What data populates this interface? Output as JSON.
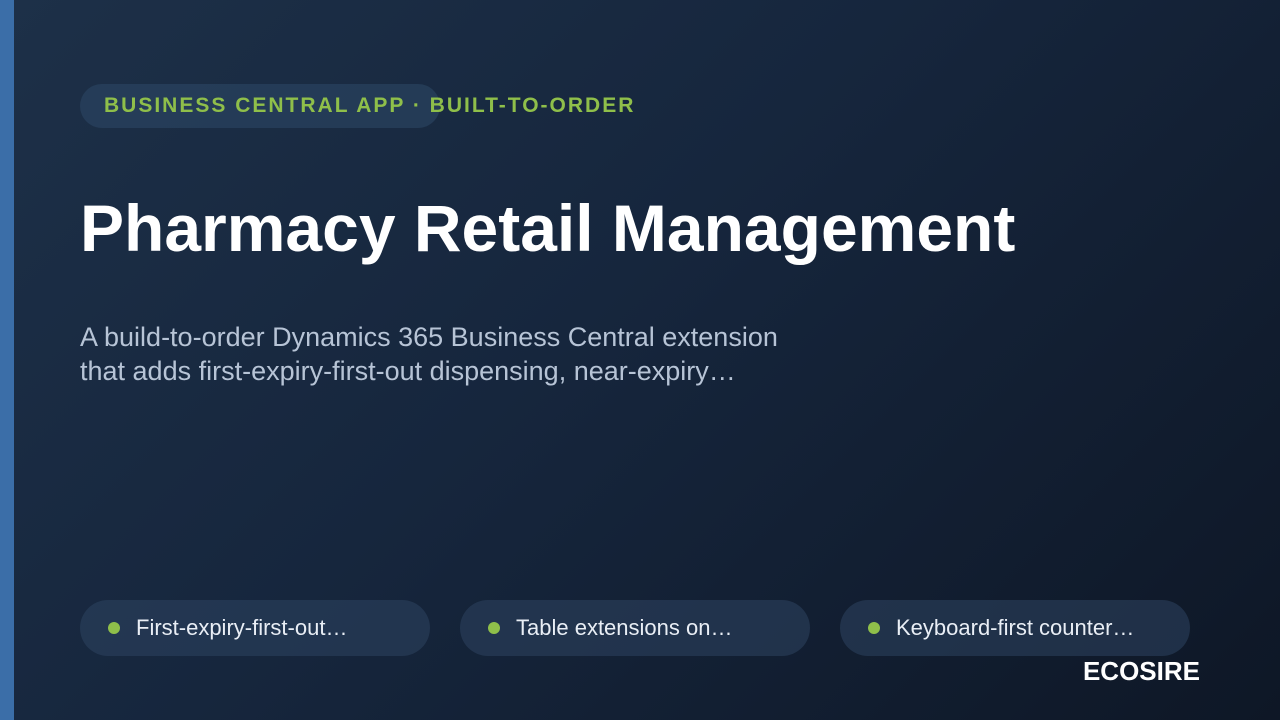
{
  "eyebrow": {
    "label": "BUSINESS CENTRAL APP · BUILT-TO-ORDER"
  },
  "title": "Pharmacy Retail Management",
  "description": {
    "line1": "A build-to-order Dynamics 365 Business Central extension",
    "line2": "that adds first-expiry-first-out dispensing, near-expiry…"
  },
  "features": [
    {
      "label": "First-expiry-first-out…"
    },
    {
      "label": "Table extensions on…"
    },
    {
      "label": "Keyboard-first counter…"
    }
  ],
  "brand": "ECOSIRE",
  "colors": {
    "accent_bar": "#3b6ea8",
    "highlight_green": "#8fbf4a",
    "background_dark": "#16263d"
  }
}
